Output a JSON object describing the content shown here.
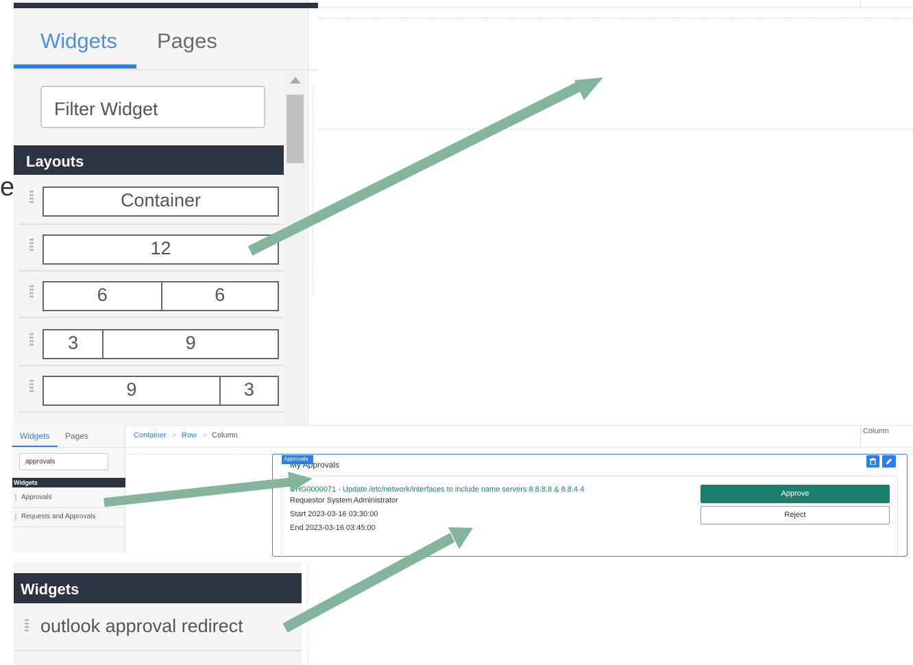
{
  "colors": {
    "accent": "#2f7fe0",
    "dark_header": "#2b3440",
    "approve_green": "#1e7e6e",
    "arrow": "#84b59c"
  },
  "partial_glyph": "e",
  "top_panel": {
    "tabs": [
      {
        "label": "Widgets",
        "active": true
      },
      {
        "label": "Pages",
        "active": false
      }
    ],
    "filter_placeholder": "Filter Widget",
    "section_header": "Layouts",
    "layouts": [
      {
        "name": "container",
        "cells": [
          "Container"
        ]
      },
      {
        "name": "12",
        "cells": [
          "12"
        ]
      },
      {
        "name": "6-6",
        "cells": [
          "6",
          "6"
        ]
      },
      {
        "name": "3-9",
        "cells": [
          "3",
          "9"
        ]
      },
      {
        "name": "9-3",
        "cells": [
          "9",
          "3"
        ]
      }
    ]
  },
  "middle_panel": {
    "tabs": [
      {
        "label": "Widgets",
        "active": true
      },
      {
        "label": "Pages",
        "active": false
      }
    ],
    "filter_value": "approvals",
    "section_header": "Widgets",
    "items": [
      "Approvals",
      "Requests and Approvals"
    ],
    "breadcrumb": {
      "items": [
        "Container",
        "Row",
        "Column"
      ],
      "separator": ">"
    },
    "column_label": "Column",
    "widget": {
      "tag": "Approvals",
      "title": "My Approvals",
      "change_link": "CHG0000071 - Update /etc/network/interfaces to include name servers 8.8.8.8 & 8.8.4.4",
      "requestor": "Requestor System Administrator",
      "start": "Start 2023-03-16 03:30:00",
      "end": "End 2023-03-16 03:45:00",
      "approve_label": "Approve",
      "reject_label": "Reject",
      "icons": [
        "trash-icon",
        "pencil-icon"
      ]
    }
  },
  "bottom_panel": {
    "section_header": "Widgets",
    "item": "outlook approval redirect"
  }
}
